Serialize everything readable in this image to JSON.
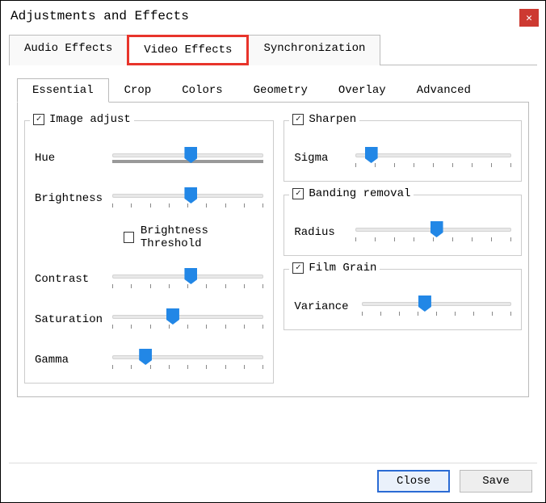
{
  "window": {
    "title": "Adjustments and Effects"
  },
  "mainTabs": {
    "t0": "Audio Effects",
    "t1": "Video Effects",
    "t2": "Synchronization"
  },
  "subTabs": {
    "s0": "Essential",
    "s1": "Crop",
    "s2": "Colors",
    "s3": "Geometry",
    "s4": "Overlay",
    "s5": "Advanced"
  },
  "imageAdjust": {
    "title": "Image adjust",
    "checked": true,
    "hue": {
      "label": "Hue",
      "pos": 52
    },
    "brightness": {
      "label": "Brightness",
      "pos": 52
    },
    "threshold": {
      "label": "Brightness Threshold",
      "checked": false
    },
    "contrast": {
      "label": "Contrast",
      "pos": 52
    },
    "saturation": {
      "label": "Saturation",
      "pos": 40
    },
    "gamma": {
      "label": "Gamma",
      "pos": 22
    }
  },
  "sharpen": {
    "title": "Sharpen",
    "checked": true,
    "sigma": {
      "label": "Sigma",
      "pos": 10
    }
  },
  "banding": {
    "title": "Banding removal",
    "checked": true,
    "radius": {
      "label": "Radius",
      "pos": 52
    }
  },
  "grain": {
    "title": "Film Grain",
    "checked": true,
    "variance": {
      "label": "Variance",
      "pos": 42
    }
  },
  "buttons": {
    "close": "Close",
    "save": "Save"
  }
}
